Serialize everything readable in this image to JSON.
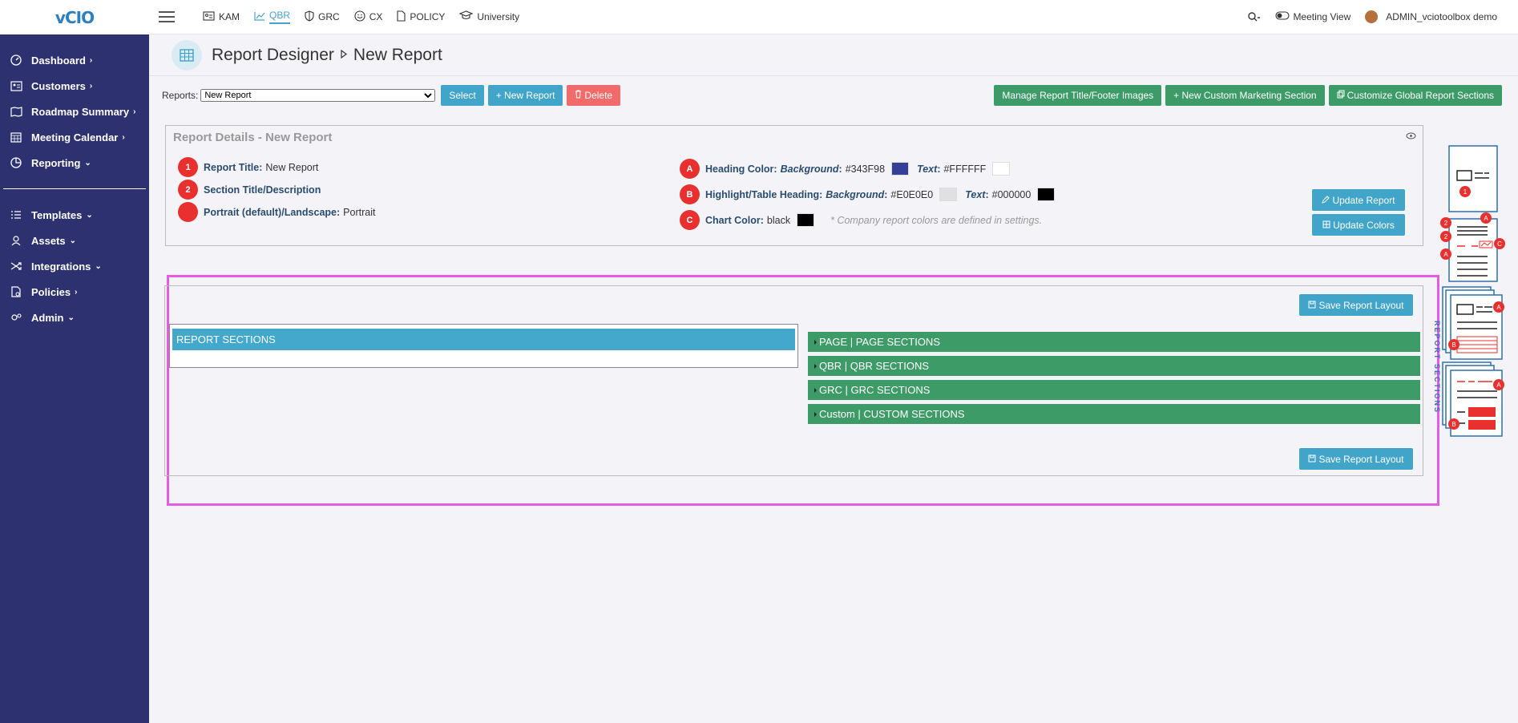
{
  "app": {
    "logo": "vCIO"
  },
  "sidebar": {
    "items": [
      {
        "label": "Dashboard",
        "icon": "dashboard-icon",
        "arrow": "›"
      },
      {
        "label": "Customers",
        "icon": "customers-icon",
        "arrow": "›"
      },
      {
        "label": "Roadmap Summary",
        "icon": "roadmap-icon",
        "arrow": "›"
      },
      {
        "label": "Meeting Calendar",
        "icon": "calendar-icon",
        "arrow": "›"
      },
      {
        "label": "Reporting",
        "icon": "reporting-icon",
        "arrow": "⌄"
      }
    ],
    "items2": [
      {
        "label": "Templates",
        "icon": "templates-icon",
        "arrow": "⌄"
      },
      {
        "label": "Assets",
        "icon": "assets-icon",
        "arrow": "⌄"
      },
      {
        "label": "Integrations",
        "icon": "integrations-icon",
        "arrow": "⌄"
      },
      {
        "label": "Policies",
        "icon": "policies-icon",
        "arrow": "›"
      },
      {
        "label": "Admin",
        "icon": "admin-icon",
        "arrow": "⌄"
      }
    ]
  },
  "topnav": {
    "tabs": [
      {
        "label": "KAM",
        "icon": "kam-icon"
      },
      {
        "label": "QBR",
        "icon": "qbr-icon",
        "active": true
      },
      {
        "label": "GRC",
        "icon": "grc-icon"
      },
      {
        "label": "CX",
        "icon": "cx-icon"
      },
      {
        "label": "POLICY",
        "icon": "policy-icon"
      },
      {
        "label": "University",
        "icon": "university-icon"
      }
    ],
    "meeting_view": "Meeting View",
    "user": "ADMIN_vciotoolbox demo"
  },
  "header": {
    "title": "Report Designer",
    "subtitle": "New Report"
  },
  "toolbar": {
    "reports_label": "Reports:",
    "selected_report": "New Report",
    "select_btn": "Select",
    "new_report_btn": "+ New Report",
    "delete_btn": "Delete",
    "manage_btn": "Manage Report Title/Footer Images",
    "custom_marketing_btn": "+ New Custom Marketing Section",
    "customize_global_btn": "Customize Global Report Sections"
  },
  "details": {
    "heading": "Report Details - New Report",
    "report_title_label": "Report Title:",
    "report_title_value": "New Report",
    "section_title_label": "Section Title/Description",
    "orientation_label": "Portrait (default)/Landscape:",
    "orientation_value": "Portrait",
    "heading_color_label": "Heading Color:",
    "background_label": "Background",
    "text_label": "Text",
    "heading_bg": "#343F98",
    "heading_text": "#FFFFFF",
    "highlight_label": "Highlight/Table Heading:",
    "highlight_bg": "#E0E0E0",
    "highlight_text": "#000000",
    "chart_color_label": "Chart Color:",
    "chart_color": "black",
    "note": "* Company report colors are defined in settings.",
    "update_report_btn": "Update Report",
    "update_colors_btn": "Update Colors",
    "badges": {
      "one": "1",
      "two": "2",
      "a": "A",
      "b": "B",
      "c": "C"
    }
  },
  "layout": {
    "save_btn": "Save Report Layout",
    "report_sections_header": "REPORT SECTIONS",
    "sections": [
      "PAGE | PAGE SECTIONS",
      "QBR | QBR SECTIONS",
      "GRC | GRC SECTIONS",
      "Custom | CUSTOM SECTIONS"
    ],
    "vertical_text": "REPORT SECTIONS"
  },
  "colors": {
    "sidebar": "#2d3170",
    "accent_blue": "#40a5c9",
    "green": "#3d9b67",
    "red": "#f26b6b",
    "badge_red": "#e8312f",
    "highlight_border": "#e45ce4",
    "swatch_heading_bg": "#343F98",
    "swatch_heading_text": "#FFFFFF",
    "swatch_highlight_bg": "#E0E0E0",
    "swatch_highlight_text": "#000000",
    "swatch_chart": "#000000"
  }
}
